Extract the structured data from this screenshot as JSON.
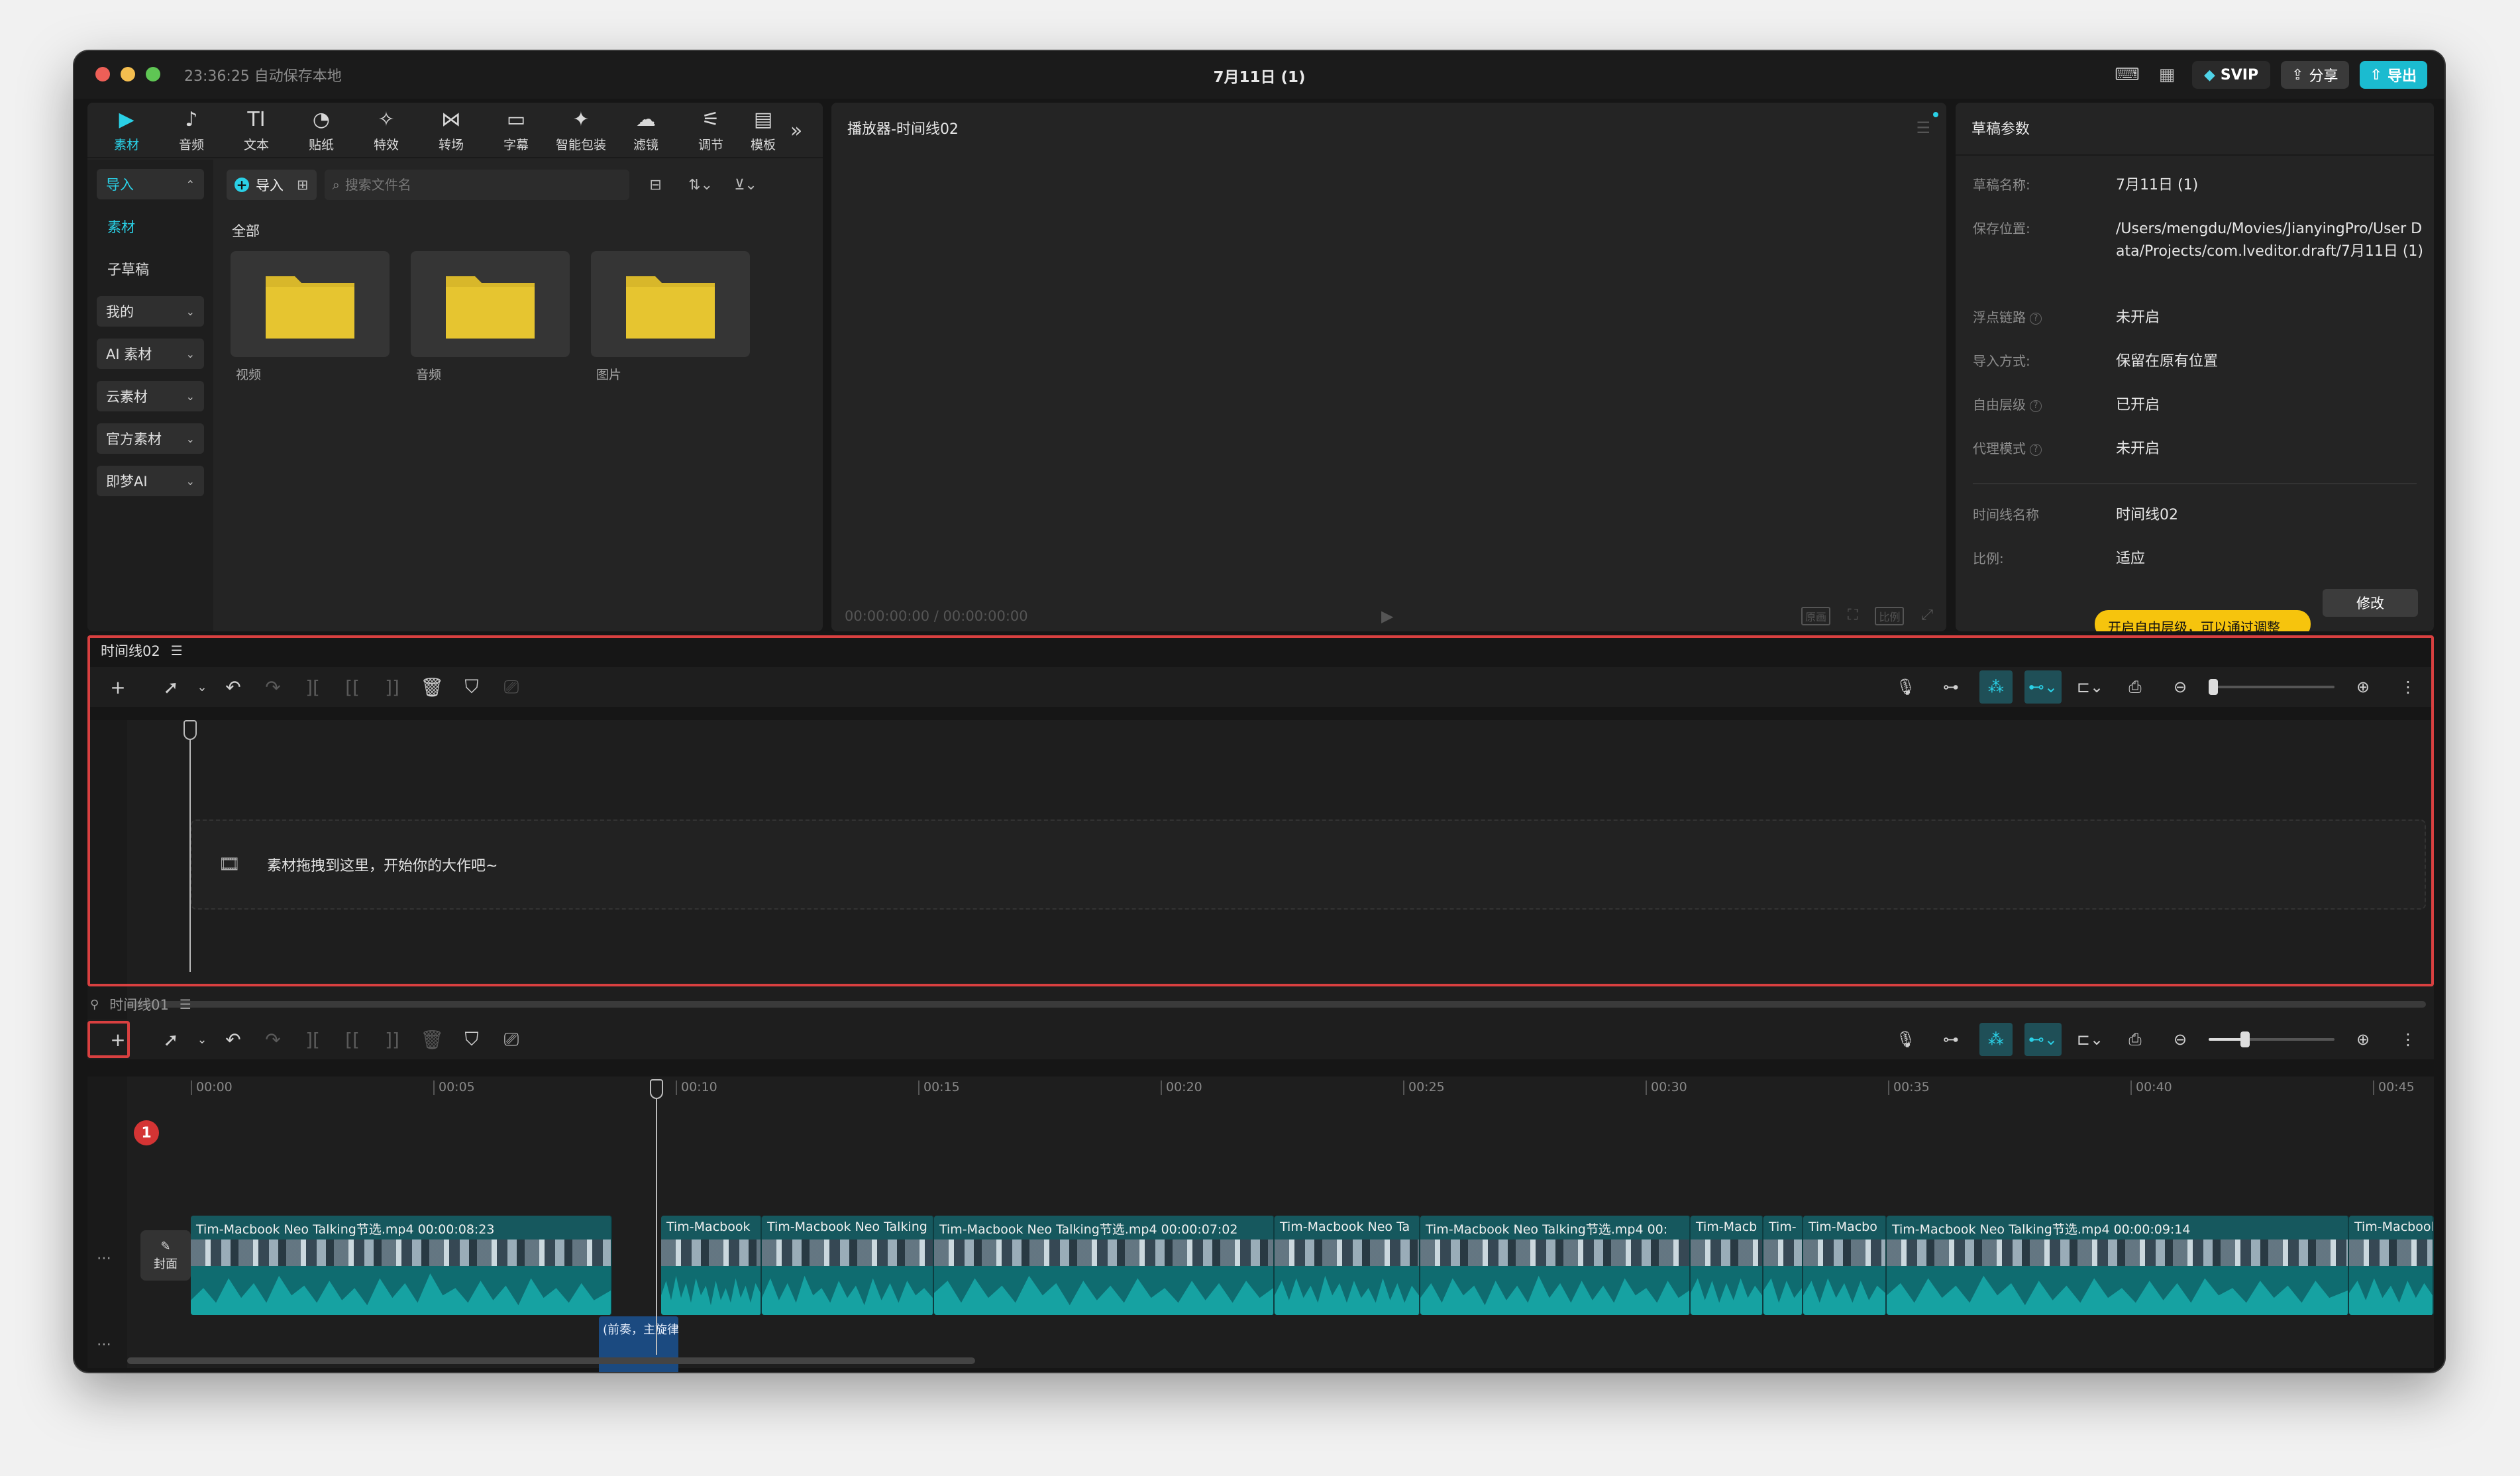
{
  "titlebar": {
    "save_status": "23:36:25 自动保存本地",
    "title": "7月11日 (1)",
    "svip": "SVIP",
    "share": "分享",
    "export": "导出"
  },
  "tools": [
    {
      "label": "素材",
      "icon": "▶",
      "icon_name": "media-icon",
      "active": true
    },
    {
      "label": "音频",
      "icon": "♪",
      "icon_name": "audio-icon"
    },
    {
      "label": "文本",
      "icon": "TI",
      "icon_name": "text-icon"
    },
    {
      "label": "贴纸",
      "icon": "◔",
      "icon_name": "sticker-icon"
    },
    {
      "label": "特效",
      "icon": "✧",
      "icon_name": "effects-icon"
    },
    {
      "label": "转场",
      "icon": "⋈",
      "icon_name": "transition-icon"
    },
    {
      "label": "字幕",
      "icon": "▭",
      "icon_name": "subtitle-icon"
    },
    {
      "label": "智能包装",
      "icon": "✦",
      "icon_name": "smart-package-icon"
    },
    {
      "label": "滤镜",
      "icon": "☁",
      "icon_name": "filter-icon"
    },
    {
      "label": "调节",
      "icon": "⚟",
      "icon_name": "adjust-icon"
    },
    {
      "label": "模板",
      "icon": "▤",
      "icon_name": "template-icon"
    }
  ],
  "side_nav": {
    "import": "导入",
    "media": "素材",
    "sub_draft": "子草稿",
    "mine": "我的",
    "ai_media": "AI 素材",
    "cloud_media": "云素材",
    "official_media": "官方素材",
    "jimeng_ai": "即梦AI"
  },
  "media": {
    "import_label": "导入",
    "search_placeholder": "搜索文件名",
    "all_label": "全部",
    "folders": [
      "视频",
      "音频",
      "图片"
    ]
  },
  "player": {
    "title": "播放器-时间线02",
    "timecode": "00:00:00:00 / 00:00:00:00",
    "ratio_label": "比例",
    "full_label": "原画"
  },
  "params": {
    "title": "草稿参数",
    "rows": [
      {
        "key": "草稿名称:",
        "value": "7月11日 (1)"
      },
      {
        "key": "保存位置:",
        "value": "/Users/mengdu/Movies/JianyingPro/User Data/Projects/com.lveditor.draft/7月11日 (1)"
      },
      {
        "key": "浮点链路",
        "value": "未开启"
      },
      {
        "key": "导入方式:",
        "value": "保留在原有位置"
      },
      {
        "key": "自由层级",
        "value": "已开启"
      },
      {
        "key": "代理模式",
        "value": "未开启"
      },
      {
        "key": "时间线名称",
        "value": "时间线02"
      },
      {
        "key": "比例:",
        "value": "适应"
      }
    ],
    "modify": "修改",
    "tip": "开启自由层级，可以通过调整"
  },
  "timeline2": {
    "name": "时间线02",
    "drop_hint": "素材拖拽到这里，开始你的大作吧~"
  },
  "timeline1": {
    "name": "时间线01",
    "badge": "1",
    "cover": "封面",
    "ticks": [
      "00:00",
      "00:05",
      "00:10",
      "00:15",
      "00:20",
      "00:25",
      "00:30",
      "00:35",
      "00:40",
      "00:45"
    ],
    "clips": [
      "Tim-Macbook Neo Talking节选.mp4  00:00:08:23",
      "Tim-Macbook",
      "Tim-Macbook Neo Talking",
      "Tim-Macbook Neo Talking节选.mp4  00:00:07:02",
      "Tim-Macbook Neo Ta",
      "Tim-Macbook Neo Talking节选.mp4  00:",
      "Tim-Macb",
      "Tim-",
      "Tim-Macbo",
      "Tim-Macbook Neo Talking节选.mp4  00:00:09:14",
      "Tim-Macbook"
    ],
    "text_clip": "(前奏，主旋律"
  },
  "colors": {
    "accent": "#2ad0e6",
    "clip": "#16585e",
    "highlight": "#d94040",
    "tip": "#f6c40d"
  }
}
